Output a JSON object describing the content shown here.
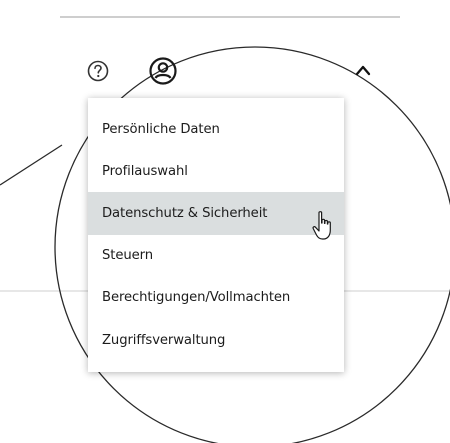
{
  "header": {
    "help_icon": "help-circle-icon",
    "profile_icon": "user-circle-icon",
    "chevron_icon": "chevron-up-icon"
  },
  "menu": {
    "items": [
      {
        "label": "Persönliche Daten"
      },
      {
        "label": "Profilauswahl"
      },
      {
        "label": "Datenschutz & Sicherheit",
        "active": true
      },
      {
        "label": "Steuern"
      },
      {
        "label": "Berechtigungen/Vollmachten"
      },
      {
        "label": "Zugriffsverwaltung"
      }
    ]
  },
  "cursor": {
    "icon": "hand-pointer-icon"
  },
  "colors": {
    "active_item_bg": "#dadedf",
    "text": "#1c1c1c",
    "outline": "#2a2a2a"
  }
}
